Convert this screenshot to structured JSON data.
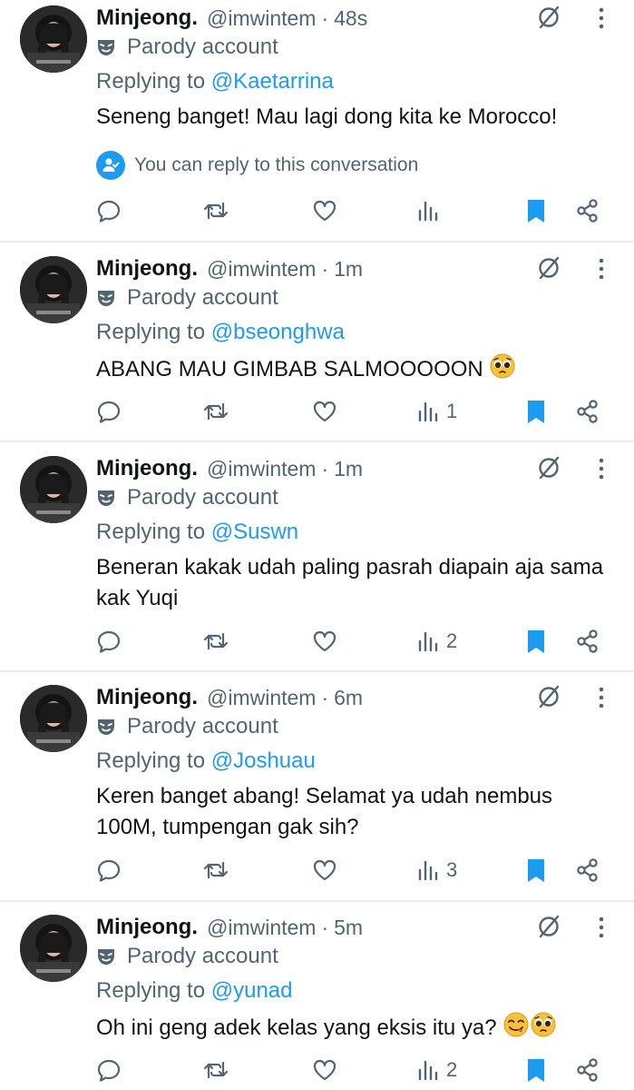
{
  "colors": {
    "accent": "#1d9bf0",
    "muted": "#536471",
    "text": "#0f1419",
    "divider": "#e6ecf0"
  },
  "conversation_notice": "You can reply to this conversation",
  "tweets": [
    {
      "name": "Minjeong.",
      "handle": "@imwintem",
      "time": "48s",
      "parody": "Parody account",
      "replying_prefix": "Replying to",
      "replying_to": "@Kaetarrina",
      "text": "Seneng banget! Mau lagi dong kita ke Morocco!",
      "emoji": [],
      "views": ""
    },
    {
      "name": "Minjeong.",
      "handle": "@imwintem",
      "time": "1m",
      "parody": "Parody account",
      "replying_prefix": "Replying to",
      "replying_to": "@bseonghwa",
      "text": "ABANG MAU GIMBAB SALMOOOOON",
      "emoji": [
        "pleading-face"
      ],
      "views": "1"
    },
    {
      "name": "Minjeong.",
      "handle": "@imwintem",
      "time": "1m",
      "parody": "Parody account",
      "replying_prefix": "Replying to",
      "replying_to": "@Suswn",
      "text": "Beneran kakak udah paling pasrah diapain aja sama kak Yuqi",
      "emoji": [],
      "views": "2"
    },
    {
      "name": "Minjeong.",
      "handle": "@imwintem",
      "time": "6m",
      "parody": "Parody account",
      "replying_prefix": "Replying to",
      "replying_to": "@Joshuau",
      "text": "Keren banget abang! Selamat ya udah nembus 100M, tumpengan gak sih?",
      "emoji": [],
      "views": "3"
    },
    {
      "name": "Minjeong.",
      "handle": "@imwintem",
      "time": "5m",
      "parody": "Parody account",
      "replying_prefix": "Replying to",
      "replying_to": "@yunad",
      "text": "Oh ini geng adek kelas yang eksis itu ya?",
      "emoji": [
        "face-savoring-food",
        "pleading-face"
      ],
      "views": "2"
    }
  ]
}
